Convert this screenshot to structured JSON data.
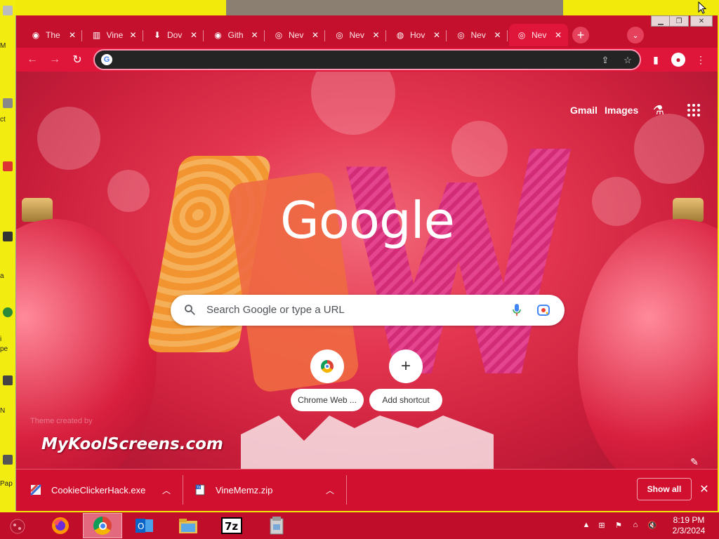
{
  "desktop": {
    "labels": [
      "M",
      "ct",
      "a",
      "i",
      "pe",
      "N",
      "Pap"
    ]
  },
  "window": {
    "controls": {
      "minimize": "▁",
      "restore": "❐",
      "close": "✕"
    }
  },
  "tabs": [
    {
      "label": "The",
      "icon": "github-icon",
      "glyph": "◉",
      "close": "✕"
    },
    {
      "label": "Vine",
      "icon": "archive-icon",
      "glyph": "▥",
      "close": "✕"
    },
    {
      "label": "Dov",
      "icon": "download-icon",
      "glyph": "⬇",
      "close": "✕"
    },
    {
      "label": "Gith",
      "icon": "github-icon",
      "glyph": "◉",
      "close": "✕"
    },
    {
      "label": "Nev",
      "icon": "chrome-icon",
      "glyph": "◎",
      "close": "✕"
    },
    {
      "label": "Nev",
      "icon": "chrome-icon",
      "glyph": "◎",
      "close": "✕"
    },
    {
      "label": "Hov",
      "icon": "globe-icon",
      "glyph": "◍",
      "close": "✕"
    },
    {
      "label": "Nev",
      "icon": "chrome-icon",
      "glyph": "◎",
      "close": "✕"
    },
    {
      "label": "Nev",
      "icon": "chrome-icon",
      "glyph": "◎",
      "close": "✕",
      "active": true
    }
  ],
  "toolbar": {
    "back": "←",
    "forward": "→",
    "reload": "↻",
    "omnibox_value": "",
    "g_glyph": "G",
    "share": "⇪",
    "star": "☆",
    "sidepanel": "▮",
    "profile": "●",
    "menu": "⋮",
    "newtab": "+",
    "tabsearch": "⌄"
  },
  "ntp": {
    "gmail": "Gmail",
    "images": "Images",
    "labs": "⚗",
    "logo": "Google",
    "search_placeholder": "Search Google or type a URL",
    "search_glyph": "🔍",
    "shortcuts": [
      {
        "label": "Chrome Web ...",
        "icon": "chrome-web-store-icon"
      },
      {
        "label": "Add shortcut",
        "icon": "plus-icon",
        "glyph": "+"
      }
    ],
    "theme_credit": "Theme created by",
    "watermark": "MyKoolScreens.com",
    "customize_glyph": "✎"
  },
  "downloads": {
    "items": [
      {
        "name": "CookieClickerHack.exe",
        "chevron": "︿"
      },
      {
        "name": "VineMemz.zip",
        "chevron": "︿"
      }
    ],
    "show_all": "Show all",
    "close": "✕"
  },
  "taskbar": {
    "time": "8:19 PM",
    "date": "2/3/2024",
    "tray": [
      "▲",
      "⊞",
      "⚑",
      "⌂",
      "🔇"
    ]
  },
  "colors": {
    "tabstrip": "#c4102c",
    "toolbar": "#e0153a",
    "taskbar": "#c00d2a"
  }
}
